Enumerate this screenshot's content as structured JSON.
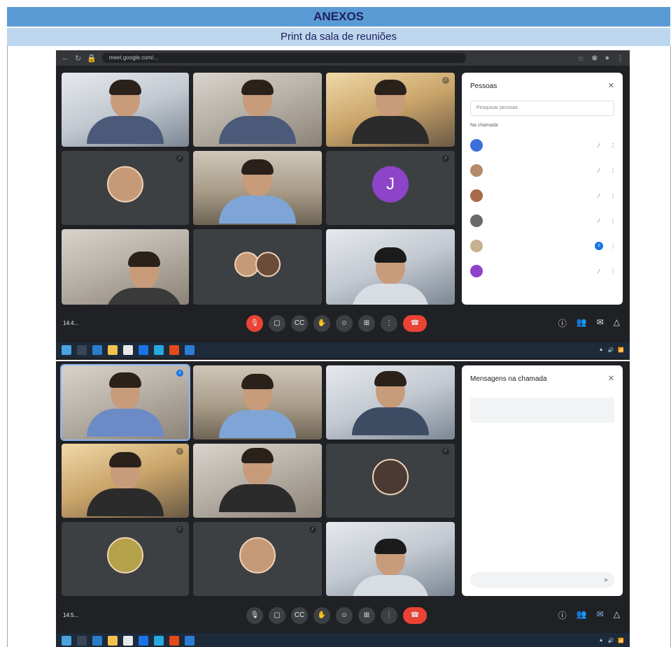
{
  "doc": {
    "section_title": "ANEXOS",
    "subtitle": "Print da sala de reuniões"
  },
  "browser": {
    "url": "meet.google.com/...",
    "icons": [
      "back-icon",
      "refresh-icon",
      "lock-icon"
    ]
  },
  "screenshot_top": {
    "tiles": [
      {
        "name": "",
        "type": "camera"
      },
      {
        "name": "",
        "type": "camera"
      },
      {
        "name": "",
        "type": "camera"
      },
      {
        "name": "",
        "type": "avatar"
      },
      {
        "name": "",
        "type": "camera"
      },
      {
        "name": "",
        "type": "avatar-letter",
        "letter": "J"
      },
      {
        "name": "",
        "type": "camera"
      },
      {
        "name": "",
        "type": "double-avatar"
      },
      {
        "name": "",
        "type": "camera"
      }
    ],
    "controls": {
      "time": "14:4...",
      "meeting_code": ""
    },
    "participants_panel": {
      "title": "Pessoas",
      "search_placeholder": "Pesquisar pessoas",
      "section": "Na chamada",
      "people": [
        {
          "name": ""
        },
        {
          "name": ""
        },
        {
          "name": ""
        },
        {
          "name": ""
        },
        {
          "name": ""
        },
        {
          "name": ""
        }
      ]
    }
  },
  "screenshot_bottom": {
    "tiles": [
      {
        "name": "",
        "type": "camera"
      },
      {
        "name": "",
        "type": "camera"
      },
      {
        "name": "",
        "type": "camera"
      },
      {
        "name": "",
        "type": "camera"
      },
      {
        "name": "",
        "type": "camera"
      },
      {
        "name": "",
        "type": "avatar"
      },
      {
        "name": "",
        "type": "avatar"
      },
      {
        "name": "",
        "type": "avatar"
      },
      {
        "name": "",
        "type": "camera"
      }
    ],
    "controls": {
      "time": "14:5...",
      "meeting_code": ""
    },
    "chat_panel": {
      "title": "Mensagens na chamada",
      "info": "",
      "messages": [
        {
          "author": "",
          "time": "",
          "text": ""
        },
        {
          "author": "",
          "time": "",
          "text": ""
        },
        {
          "author": "",
          "time": "",
          "text": ""
        }
      ],
      "input_placeholder": ""
    }
  },
  "colors": {
    "header_blue": "#5b9bd5",
    "subheader_blue": "#bdd7ee",
    "meet_bg": "#202124",
    "end_call_red": "#ea4335"
  }
}
